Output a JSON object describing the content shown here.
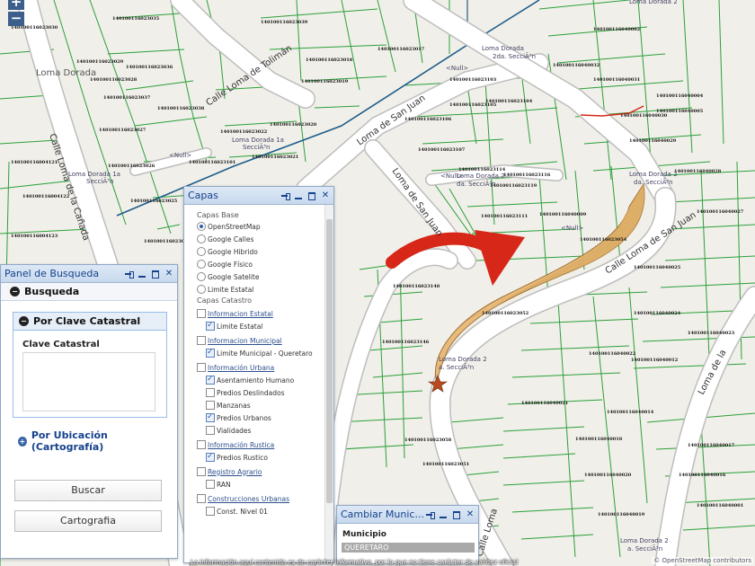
{
  "map": {
    "area_labels": {
      "loma_dorada": "Loma Dorada",
      "loma_dorada_1a_top": "Loma Dorada 1a",
      "loma_dorada_1a_seccion_top": "SecciÃ³n",
      "loma_dorada_1a_left": "Loma Dorada 1a",
      "loma_dorada_1a_seccion_left": "SecciÃ³n",
      "loma_dorada_2_top": "Loma Dorada",
      "loma_dorada_2_top_b": "2da. SecciÃ³n",
      "loma_dorada_2_mid": "Loma Dorada 2",
      "loma_dorada_2_mid_b": "da. SecciÃ³n",
      "loma_dorada_2_right": "Loma Dorada 2",
      "loma_dorada_2_right_b": "da. SecciÃ³n",
      "loma_dorada_2_center": "Loma Dorada 2",
      "loma_dorada_2_center_b": "a. SecciÃ³n",
      "loma_dorada_2_bottom": "Loma Dorada 2",
      "loma_dorada_2_bottom_b": "a. SecciÃ³n",
      "null_a": "<Null>",
      "null_b": "<Null>",
      "null_c": "<Null>",
      "null_d": "<Null>"
    },
    "street_labels": {
      "loma_de_la_canada": "Calle Loma de la Cañada",
      "loma_de_toliman": "Calle Loma de Tolimán",
      "loma_de_san_juan_a": "Loma de San Juan",
      "loma_de_san_juan_b": "Loma de San Juan",
      "calle_loma_de_san_juan": "Calle Loma de San Juan",
      "loma_de_la_right": "Loma de la",
      "calle_loma_bottom": "Calle Loma"
    },
    "parcel_ids": [
      "140100116023030",
      "140100116023035",
      "140100116023039",
      "140100116023029",
      "140100116023036",
      "140100116023028",
      "140100116023018",
      "140100116023017",
      "140100116023019",
      "140100116023037",
      "140100116023038",
      "140100116023027",
      "140100116023020",
      "140100116023022",
      "140100116023021",
      "140100116023101",
      "140100116004121",
      "140100116023026",
      "140100116004122",
      "140100116023025",
      "140100116004123",
      "140100116023024",
      "140100116023103",
      "140100116023104",
      "140100116023105",
      "140100116023106",
      "140100116023107",
      "140100116023114",
      "140100116023116",
      "140100116023119",
      "140100116023111",
      "140100116023054",
      "140100116040002",
      "140100116040032",
      "140100116040031",
      "140100116040004",
      "140100116040030",
      "140100116040005",
      "140100116040029",
      "140100116040028",
      "140100116040027",
      "140100116040025",
      "140100116040024",
      "140100116040023",
      "140100116040022",
      "140100116040012",
      "140100116040021",
      "140100116040014",
      "140100116040020",
      "140100116040019",
      "140100116023058",
      "140100116040018",
      "140100116040017",
      "140100116040016",
      "140100116040001",
      "140100116023148",
      "140100116023146",
      "140100116040009",
      "140100116023052",
      "140100116023051"
    ],
    "attribution": "© OpenStreetMap contributors"
  },
  "zoom": {
    "in": "+",
    "out": "−"
  },
  "panel_busqueda": {
    "title": "Panel de Busqueda",
    "section": "Busqueda",
    "clave_header": "Por Clave Catastral",
    "clave_label": "Clave Catastral",
    "ubicacion_header": "Por Ubicación (Cartografía)",
    "buscar_button": "Buscar",
    "cartografia_button": "Cartografia"
  },
  "capas": {
    "title": "Capas",
    "base_label": "Capas Base",
    "base_layers": [
      "OpenStreetMap",
      "Google Calles",
      "Google Hibrido",
      "Google Físico",
      "Google Satelite",
      "Limite Estatal"
    ],
    "catastro_label": "Capas Catastro",
    "groups": [
      {
        "name": "Informacion Estatal",
        "items": [
          "Limite Estatal"
        ]
      },
      {
        "name": "Informacion Municipal",
        "items": [
          "Limite Municipal - Queretaro"
        ]
      },
      {
        "name": "Información Urbana",
        "items": [
          "Asentamiento Humano",
          "Predios Deslindados",
          "Manzanas",
          "Predios Urbanos",
          "Vialidades"
        ]
      },
      {
        "name": "Información Rustica",
        "items": [
          "Predios Rustico"
        ]
      },
      {
        "name": "Registro Agrario",
        "items": [
          "RAN"
        ]
      },
      {
        "name": "Construcciones Urbanas",
        "items": [
          "Const. Nivel 01"
        ]
      }
    ]
  },
  "cambiar_municipio": {
    "title": "Cambiar Munic...",
    "label": "Municipio",
    "value": "QUERETARO"
  },
  "footer": {
    "notice": "La información aquí contenida es de carácter informativo, por lo que no tiene carácter de validez oficial"
  },
  "colors": {
    "parcel_line": "#2aa03a",
    "road_fill": "#ffffff",
    "highlight_fill": "#e8b977",
    "arrow": "#d62718",
    "municipal_line": "#1d5d8a"
  }
}
